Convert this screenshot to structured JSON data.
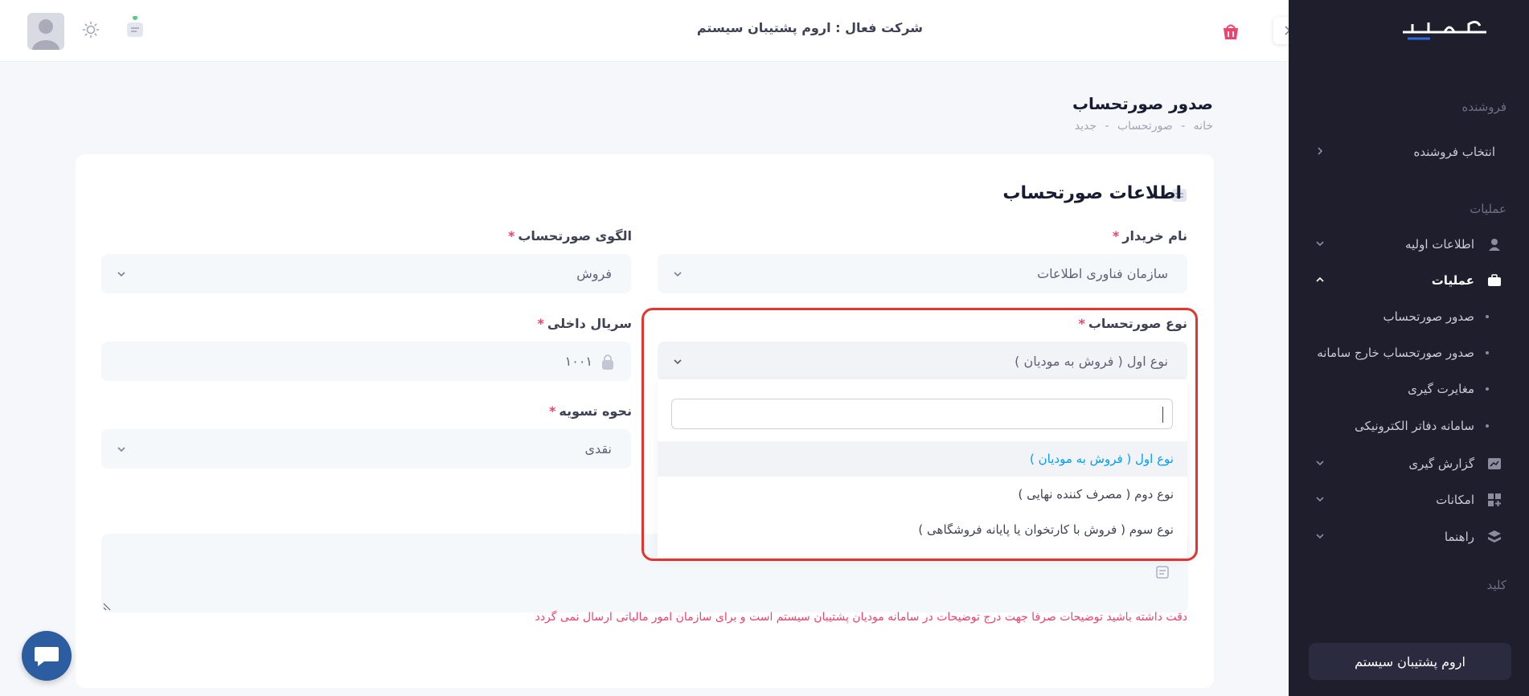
{
  "header": {
    "active_company": "شرکت فعال : اروم پشتیبان سیستم"
  },
  "sidebar": {
    "logo_text": "آسپاد",
    "section_seller": "فروشنده",
    "select_seller": "انتخاب فروشنده",
    "section_operations": "عملیات",
    "items": [
      {
        "label": "اطلاعات اولیه",
        "icon": "user-icon"
      },
      {
        "label": "عملیات",
        "icon": "briefcase-icon"
      },
      {
        "label": "گزارش گیری",
        "icon": "chart-icon"
      },
      {
        "label": "امکانات",
        "icon": "apps-icon"
      },
      {
        "label": "راهنما",
        "icon": "layers-icon"
      }
    ],
    "subitems": [
      {
        "label": "صدور صورتحساب"
      },
      {
        "label": "صدور صورتحساب خارج سامانه"
      },
      {
        "label": "مغایرت گیری"
      },
      {
        "label": "سامانه دفاتر الکترونیکی"
      }
    ],
    "section_key": "کلید",
    "company_box": "اروم پشتیبان سیستم"
  },
  "page": {
    "title": "صدور صورتحساب",
    "breadcrumb": [
      "خانه",
      "-",
      "صورتحساب",
      "-",
      "جدید"
    ]
  },
  "card": {
    "title": "اطلاعات صورتحساب",
    "fields": {
      "buyer_label": "نام خریدار",
      "buyer_value": "سازمان فناوری اطلاعات",
      "pattern_label": "الگوی صورتحساب",
      "pattern_value": "فروش",
      "invoice_type_label": "نوع صورتحساب",
      "invoice_type_value": "نوع اول ( فروش به مودیان )",
      "serial_label": "سریال داخلی",
      "serial_value": "۱۰۰۱",
      "settlement_label": "نحوه تسویه",
      "settlement_value": "نقدی"
    },
    "required_mark": "*",
    "dropdown_options": [
      {
        "label": "نوع اول ( فروش به مودیان )",
        "selected": true
      },
      {
        "label": "نوع دوم ( مصرف کننده نهایی )",
        "selected": false
      },
      {
        "label": "نوع سوم ( فروش با کارتخوان یا پایانه فروشگاهی )",
        "selected": false
      }
    ],
    "warning": "دقت داشته باشید توضیحات صرفا جهت درج توضیحات در سامانه مودیان پشتیبان سیستم است و برای سازمان امور مالیاتی ارسال نمی گردد"
  },
  "colors": {
    "sidebar_bg": "#1e1e2d",
    "accent": "#009ef7",
    "required": "#f1416c",
    "highlight": "#e3342f"
  }
}
